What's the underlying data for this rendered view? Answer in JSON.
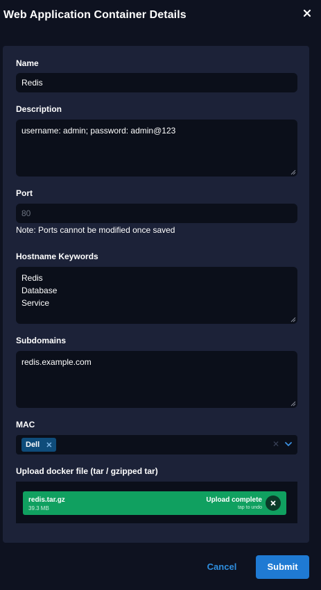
{
  "dialog": {
    "title": "Web Application Container Details"
  },
  "form": {
    "name": {
      "label": "Name",
      "value": "Redis"
    },
    "description": {
      "label": "Description",
      "value": "username: admin; password: admin@123"
    },
    "port": {
      "label": "Port",
      "value": "80",
      "note": "Note: Ports cannot be modified once saved"
    },
    "hostname_keywords": {
      "label": "Hostname Keywords",
      "lines": [
        "Redis",
        "Database",
        "Service"
      ]
    },
    "subdomains": {
      "label": "Subdomains",
      "value": "redis.example.com"
    },
    "mac": {
      "label": "MAC",
      "selected": [
        "Dell"
      ]
    },
    "upload": {
      "label": "Upload docker file (tar / gzipped tar)",
      "file_name": "redis.tar.gz",
      "file_size": "39.3 MB",
      "status": "Upload complete",
      "hint": "tap to undo"
    }
  },
  "footer": {
    "cancel_label": "Cancel",
    "submit_label": "Submit"
  },
  "colors": {
    "background": "#0e1220",
    "panel": "#1c2238",
    "input": "#0b0f1a",
    "accent": "#1f7ad3",
    "success": "#10a060"
  },
  "icons": {
    "close": "close-icon",
    "clear": "clear-icon",
    "chevron": "chevron-down-icon",
    "undo": "undo-icon"
  }
}
